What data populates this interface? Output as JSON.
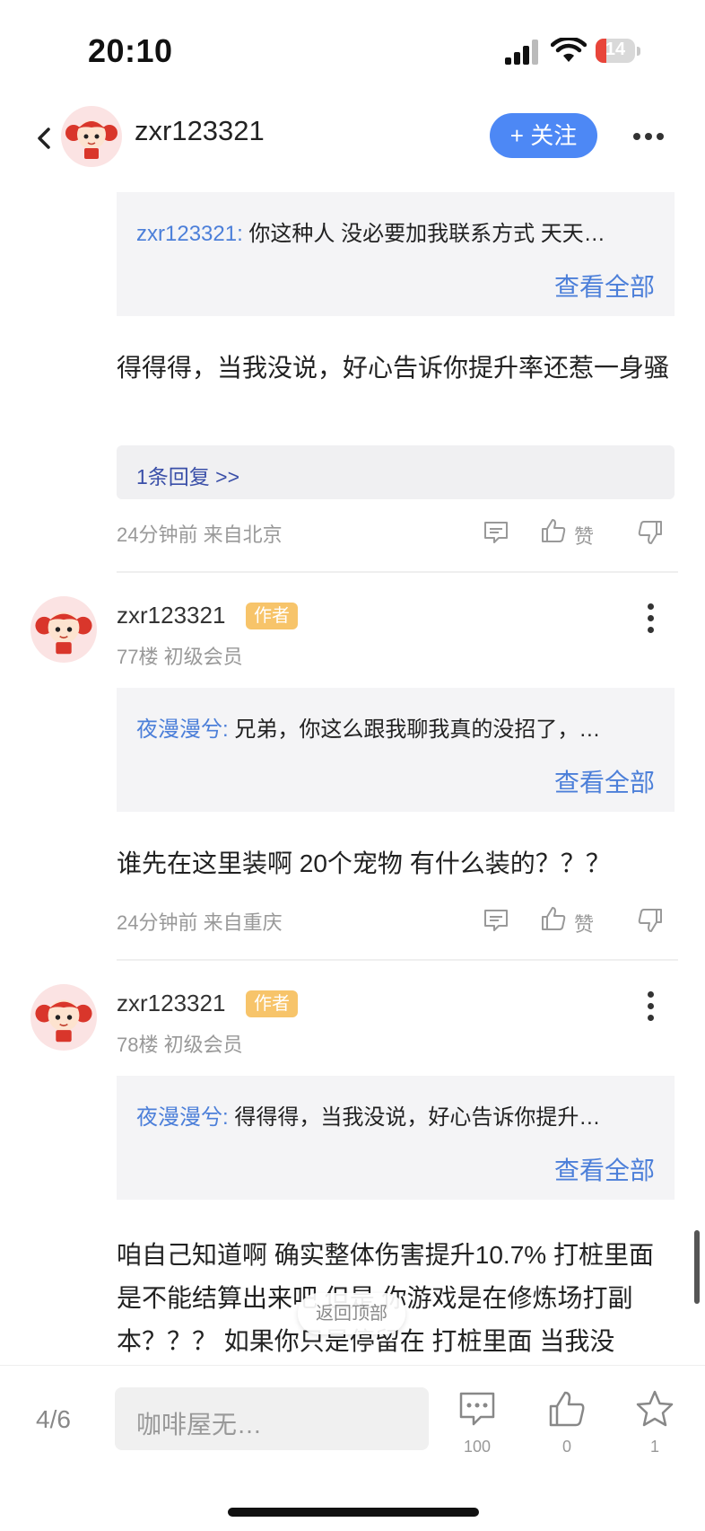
{
  "status_bar": {
    "time": "20:10",
    "battery": "14"
  },
  "header": {
    "username": "zxr123321",
    "follow_label": "+ 关注"
  },
  "top_fragment": {
    "reply": {
      "author": "zxr123321:",
      "text": " 你这种人 没必要加我联系方式  天天…",
      "view_all": "查看全部"
    },
    "body": "得得得，当我没说，好心告诉你提升率还惹一身骚",
    "more_replies": "1条回复 >>",
    "meta": "24分钟前 来自北京",
    "like_label": "赞"
  },
  "posts": [
    {
      "username": "zxr123321",
      "badge": "作者",
      "floor": "77楼  初级会员",
      "reply": {
        "author": "夜漫漫兮:",
        "text": " 兄弟，你这么跟我聊我真的没招了，…",
        "view_all": "查看全部"
      },
      "body": "谁先在这里装啊  20个宠物 有什么装的？？？",
      "meta": "24分钟前 来自重庆",
      "like_label": "赞"
    },
    {
      "username": "zxr123321",
      "badge": "作者",
      "floor": "78楼  初级会员",
      "reply": {
        "author": "夜漫漫兮:",
        "text": " 得得得，当我没说，好心告诉你提升…",
        "view_all": "查看全部"
      },
      "body": "咱自己知道啊 确实整体伤害提升10.7% 打桩里面是不能结算出来吧 但是 你游戏是在修炼场打副本？？？ 如果你只是停留在 打桩里面 当我没"
    }
  ],
  "back_to_top": "返回顶部",
  "bottom_bar": {
    "pager": "4/6",
    "input_placeholder": "咖啡屋无…",
    "comment_count": "100",
    "like_count": "0",
    "star_count": "1"
  },
  "colors": {
    "accent": "#4d88f5",
    "link": "#4c7fd9",
    "badge": "#f7c46a",
    "battery_low": "#e8453a"
  },
  "icons": [
    "back-icon",
    "more-horizontal-icon",
    "reply-icon",
    "thumbs-up-icon",
    "thumbs-down-icon",
    "more-vertical-icon",
    "comment-icon",
    "star-icon"
  ]
}
